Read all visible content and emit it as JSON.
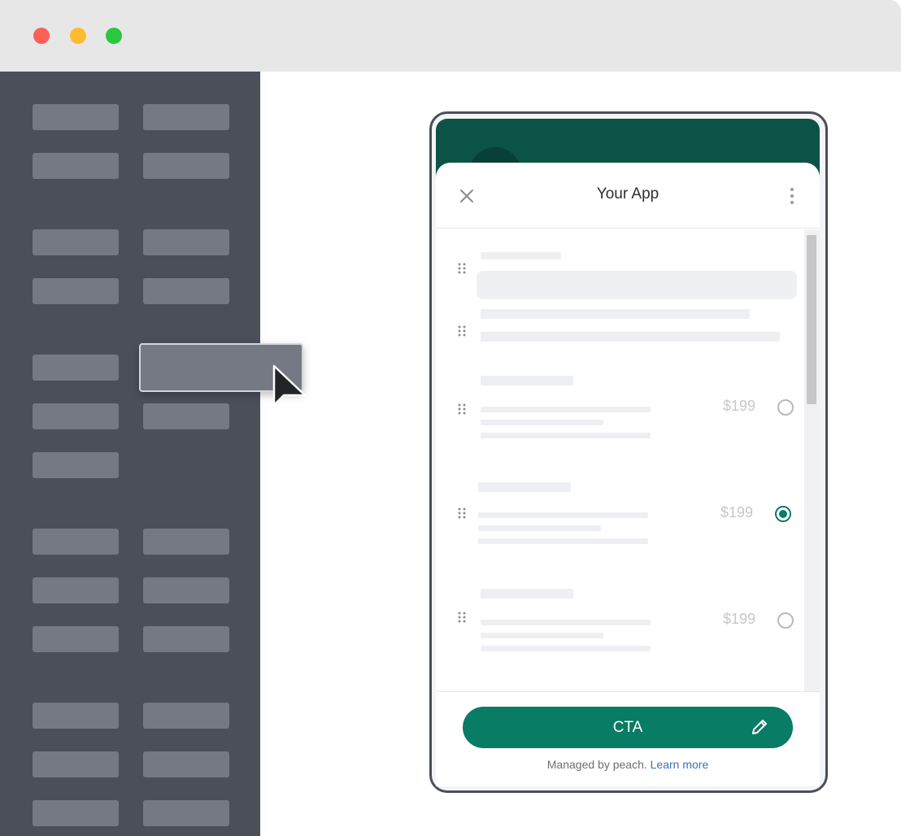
{
  "window": {
    "controls": [
      "close",
      "minimize",
      "maximize"
    ]
  },
  "app": {
    "title": "Your App",
    "icons": {
      "close": "close-icon",
      "menu": "kebab-icon",
      "drag": "grip-icon",
      "edit": "pencil-icon",
      "cursor": "pointer-cursor-icon"
    }
  },
  "options": [
    {
      "price": "$199",
      "selected": false
    },
    {
      "price": "$199",
      "selected": true
    },
    {
      "price": "$199",
      "selected": false
    }
  ],
  "cta": {
    "label": "CTA"
  },
  "footer": {
    "text": "Managed by peach.",
    "link": "Learn more"
  },
  "colors": {
    "sidebar": "#4a4f5a",
    "sidebar_block": "#747983",
    "header": "#0b5347",
    "accent": "#087c64",
    "link": "#3f6ec2"
  }
}
